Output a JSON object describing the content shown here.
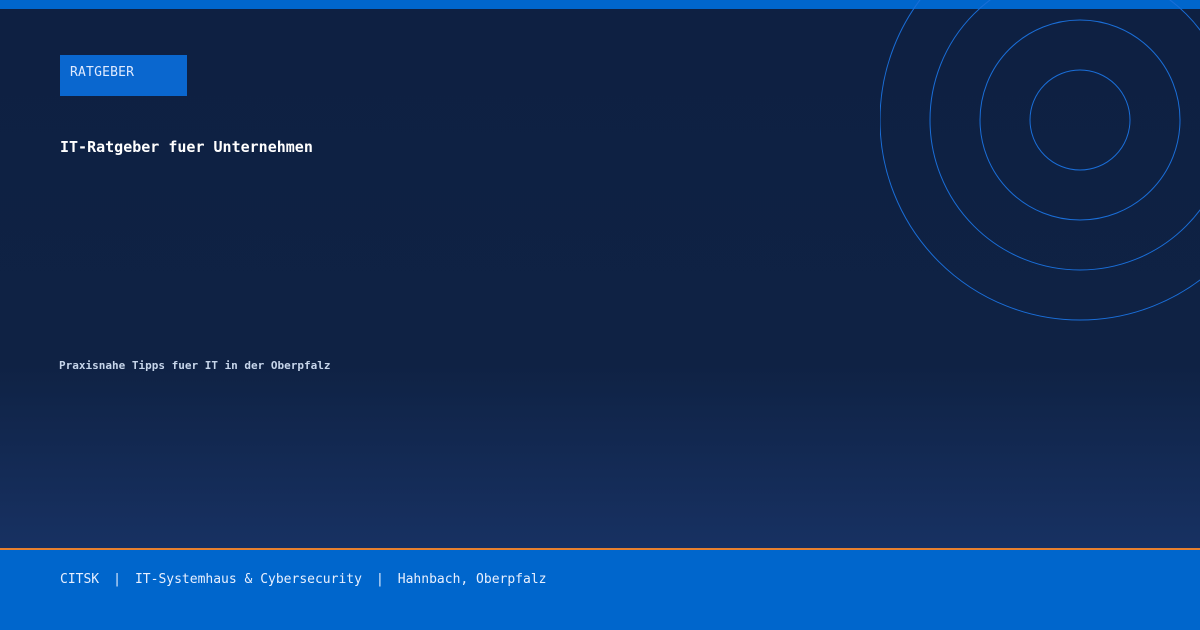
{
  "badge": {
    "label": "RATGEBER"
  },
  "header": {
    "title": "IT-Ratgeber fuer Unternehmen",
    "subtitle": "Praxisnahe Tipps fuer IT in der Oberpfalz"
  },
  "footer": {
    "brand": "CITSK",
    "separator": "|",
    "tagline": "IT-Systemhaus & Cybersecurity",
    "location": "Hahnbach, Oberpfalz"
  },
  "colors": {
    "background": "#0f2244",
    "accent": "#0066cc",
    "footer_line": "#e8812f",
    "ring_stroke": "#1a6ed8"
  }
}
